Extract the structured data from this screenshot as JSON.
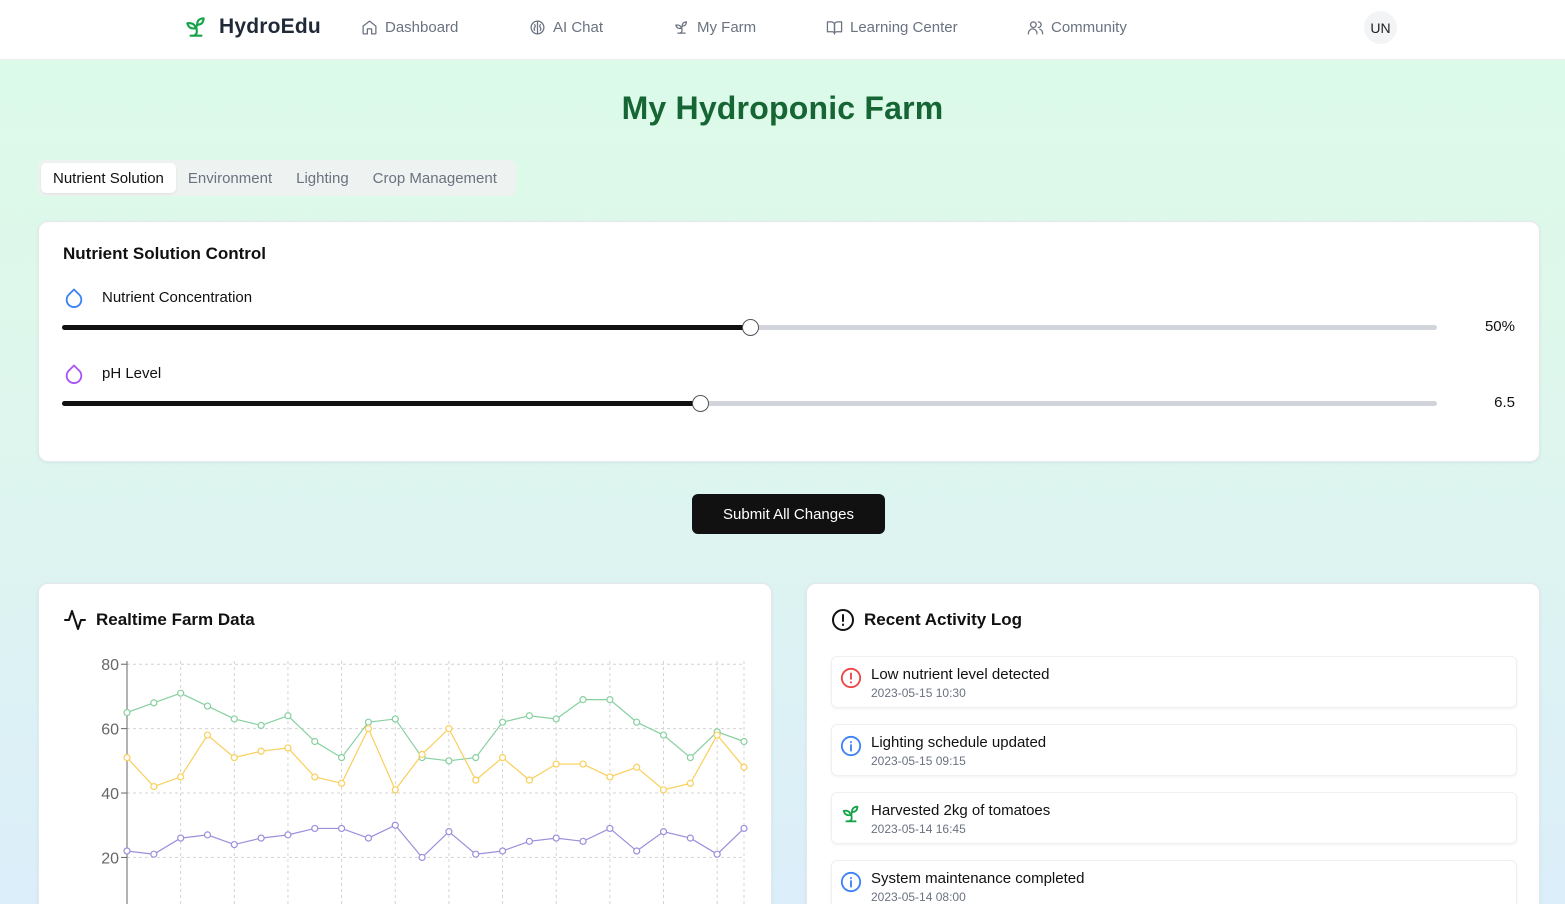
{
  "nav": {
    "brand": "HydroEdu",
    "items": [
      {
        "label": "Dashboard",
        "icon": "home-icon"
      },
      {
        "label": "AI Chat",
        "icon": "brain-icon"
      },
      {
        "label": "My Farm",
        "icon": "sprout-icon"
      },
      {
        "label": "Learning Center",
        "icon": "book-icon"
      },
      {
        "label": "Community",
        "icon": "users-icon"
      }
    ],
    "avatar": "UN"
  },
  "page_title": "My Hydroponic Farm",
  "tabs": [
    "Nutrient Solution",
    "Environment",
    "Lighting",
    "Crop Management"
  ],
  "active_tab": "Nutrient Solution",
  "control": {
    "title": "Nutrient Solution Control",
    "nutrient": {
      "label": "Nutrient Concentration",
      "value": "50%",
      "fraction": 0.5,
      "icon_color": "#3b82f6"
    },
    "ph": {
      "label": "pH Level",
      "value": "6.5",
      "fraction": 0.464,
      "icon_color": "#a855f7"
    }
  },
  "submit_label": "Submit All Changes",
  "chart": {
    "title": "Realtime Farm Data",
    "chart_data": {
      "type": "line",
      "x": [
        0,
        1,
        2,
        3,
        4,
        5,
        6,
        7,
        8,
        9,
        10,
        11,
        12,
        13,
        14,
        15,
        16,
        17,
        18,
        19,
        20,
        21,
        22,
        23
      ],
      "yticks": [
        "80",
        "60",
        "40",
        "20"
      ],
      "ylim": [
        0,
        81
      ],
      "grid": true,
      "series": [
        {
          "color": "#86d0a0",
          "values": [
            65,
            68,
            71,
            67,
            63,
            61,
            64,
            56,
            51,
            62,
            63,
            51,
            50,
            51,
            62,
            64,
            63,
            69,
            69,
            62,
            58,
            51,
            59,
            56
          ]
        },
        {
          "color": "#f9cf5a",
          "values": [
            51,
            42,
            45,
            58,
            51,
            53,
            54,
            45,
            43,
            60,
            41,
            52,
            60,
            44,
            51,
            44,
            49,
            49,
            45,
            48,
            41,
            43,
            58,
            48
          ]
        },
        {
          "color": "#9b8fdc",
          "values": [
            22,
            21,
            26,
            27,
            24,
            26,
            27,
            29,
            29,
            26,
            30,
            20,
            28,
            21,
            22,
            25,
            26,
            25,
            29,
            22,
            28,
            26,
            21,
            29
          ]
        }
      ]
    }
  },
  "log": {
    "title": "Recent Activity Log",
    "items": [
      {
        "text": "Low nutrient level detected",
        "time": "2023-05-15 10:30",
        "icon": "alert-icon",
        "color": "#ef4444"
      },
      {
        "text": "Lighting schedule updated",
        "time": "2023-05-15 09:15",
        "icon": "info-icon",
        "color": "#3b82f6"
      },
      {
        "text": "Harvested 2kg of tomatoes",
        "time": "2023-05-14 16:45",
        "icon": "sprout-icon",
        "color": "#16a34a"
      },
      {
        "text": "System maintenance completed",
        "time": "2023-05-14 08:00",
        "icon": "info-icon",
        "color": "#3b82f6"
      }
    ]
  }
}
